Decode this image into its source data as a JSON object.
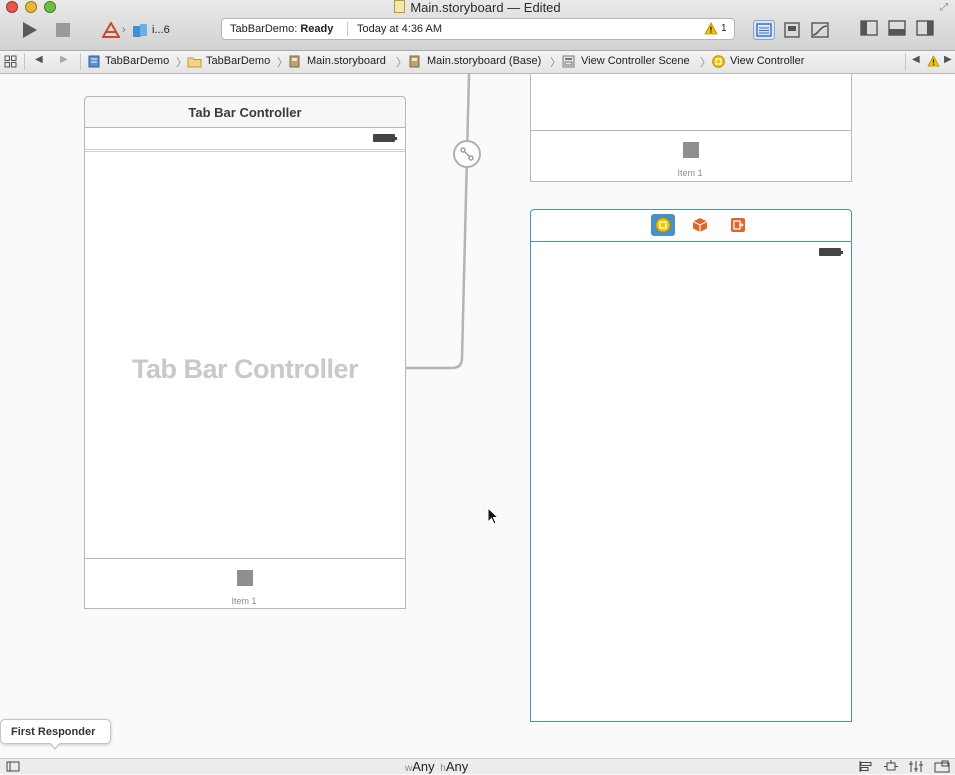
{
  "window": {
    "title": "Main.storyboard — Edited"
  },
  "toolbar": {
    "scheme_label": "i...6",
    "status_project": "TabBarDemo:",
    "status_state": "Ready",
    "status_time": "Today at 4:36 AM",
    "warning_count": "1"
  },
  "jumpbar": {
    "crumbs": [
      "TabBarDemo",
      "TabBarDemo",
      "Main.storyboard",
      "Main.storyboard (Base)",
      "View Controller Scene",
      "View Controller"
    ]
  },
  "canvas": {
    "tab_bar_scene_title": "Tab Bar Controller",
    "tab_bar_placeholder": "Tab Bar Controller",
    "tab_item_label": "Item 1",
    "top_scene_item_label": "Item 1",
    "first_responder": "First Responder"
  },
  "bottom": {
    "w_prefix": "w",
    "w_value": "Any",
    "h_prefix": "h",
    "h_value": "Any"
  },
  "colors": {
    "selection_blue": "#4a90c8",
    "scene_dock_accent": "#e0652a",
    "warning_yellow": "#f2c200"
  }
}
